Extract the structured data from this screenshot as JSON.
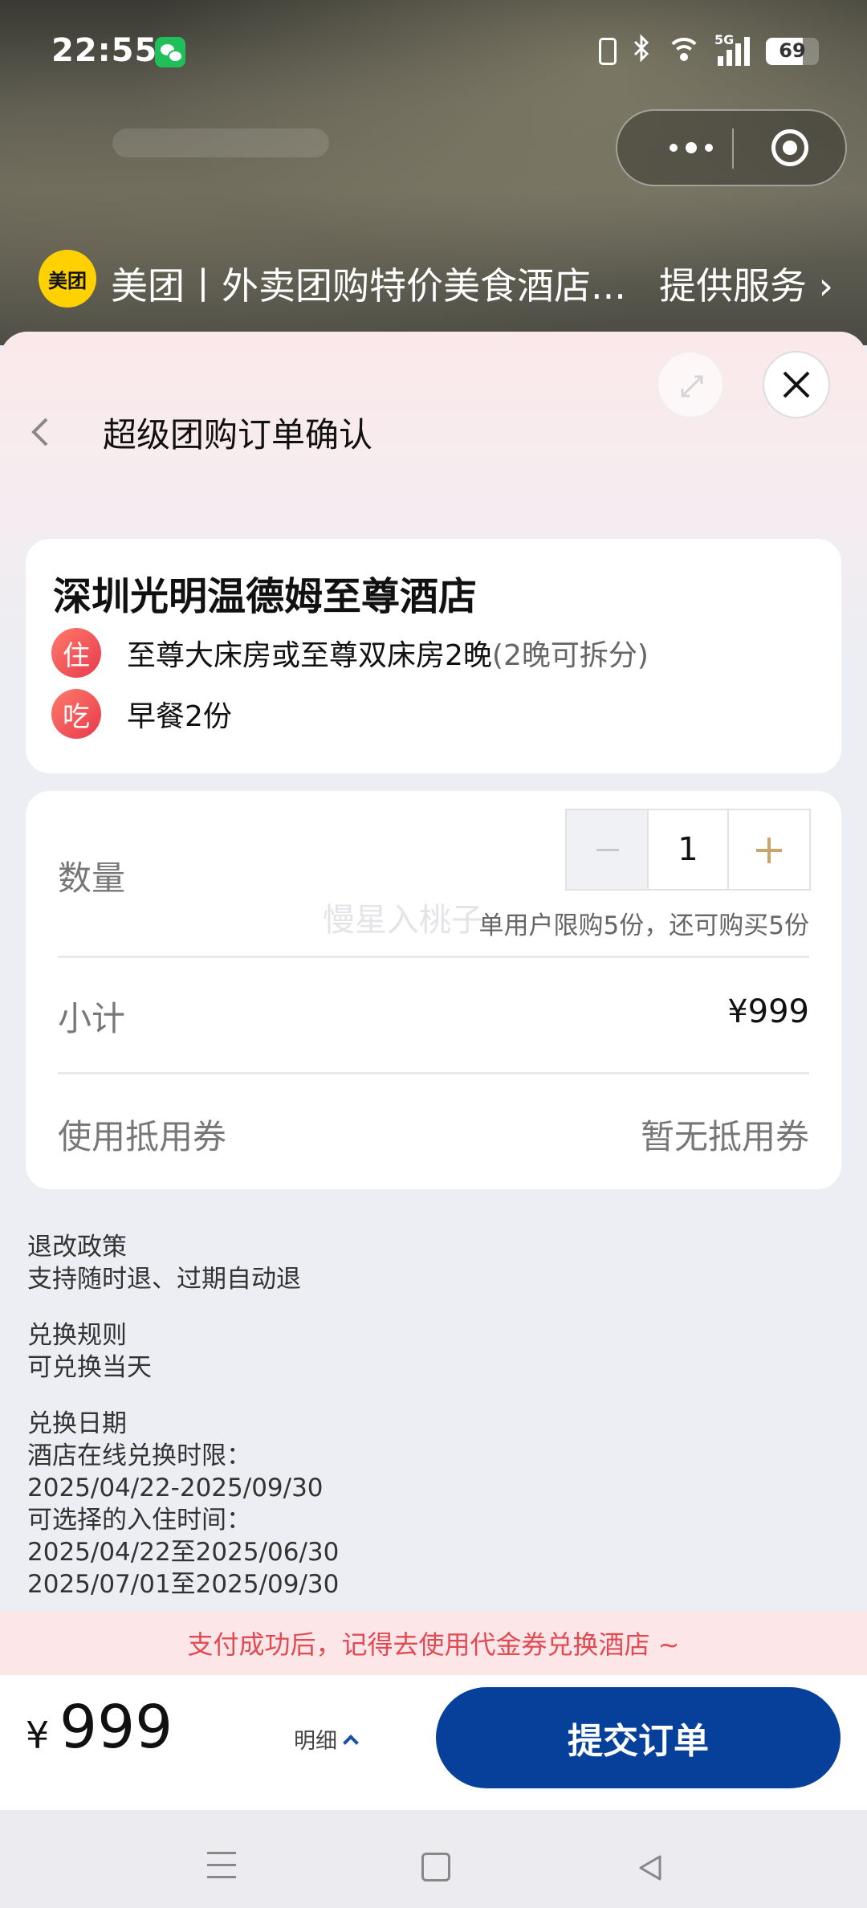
{
  "status_bar": {
    "time": "22:55",
    "network": "5G",
    "battery": "69",
    "icons": [
      "wechat-icon",
      "vibrate-icon",
      "bluetooth-icon",
      "wifi-icon",
      "signal-icon",
      "battery-icon"
    ]
  },
  "capsule": {
    "more_icon": "more-dots-icon",
    "close_icon": "target-icon"
  },
  "service_bar": {
    "logo_text": "美团",
    "name": "美团丨外卖团购特价美食酒店...",
    "provider": "提供服务 ›"
  },
  "header": {
    "back_icon": "chevron-left-icon",
    "title": "超级团购订单确认",
    "expand_icon": "expand-icon",
    "close_icon": "close-icon"
  },
  "hotel": {
    "name": "深圳光明温德姆至尊酒店",
    "features": [
      {
        "badge": "住",
        "text": "至尊大床房或至尊双床房2晚",
        "note": "(2晚可拆分)"
      },
      {
        "badge": "吃",
        "text": "早餐2份",
        "note": ""
      }
    ]
  },
  "order": {
    "quantity_label": "数量",
    "quantity": "1",
    "limit_text": "单用户限购5份，还可购买5份",
    "watermark": "慢星入桃子",
    "subtotal_label": "小计",
    "subtotal_value": "¥999",
    "coupon_label": "使用抵用券",
    "coupon_value": "暂无抵用券"
  },
  "policies": [
    {
      "title": "退改政策",
      "lines": [
        "支持随时退、过期自动退"
      ]
    },
    {
      "title": "兑换规则",
      "lines": [
        "可兑换当天"
      ]
    },
    {
      "title": "兑换日期",
      "lines": [
        "酒店在线兑换时限：",
        "2025/04/22-2025/09/30",
        "可选择的入住时间：",
        "2025/04/22至2025/06/30",
        "2025/07/01至2025/09/30"
      ]
    }
  ],
  "tip": "支付成功后，记得去使用代金券兑换酒店 ~",
  "footer": {
    "currency": "¥",
    "price": "999",
    "detail_label": "明细",
    "submit_label": "提交订单"
  },
  "colors": {
    "brand_yellow": "#ffd100",
    "submit_blue": "#06409a",
    "tip_red": "#e14a52",
    "badge_red": "#e83a4d",
    "plus_gold": "#c9a46b"
  }
}
